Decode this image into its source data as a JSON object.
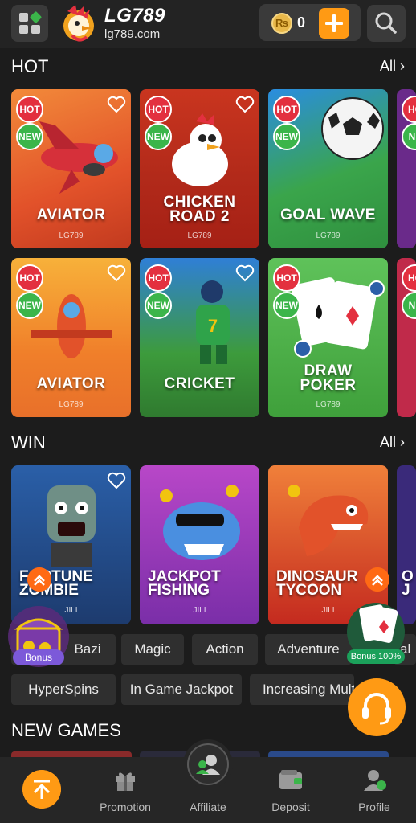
{
  "header": {
    "logo_title": "LG789",
    "logo_url": "lg789.com",
    "balance": "0",
    "currency_symbol": "₨"
  },
  "sections": {
    "hot": {
      "title": "HOT",
      "all_label": "All"
    },
    "win": {
      "title": "WIN",
      "all_label": "All"
    },
    "new_games": {
      "title": "NEW GAMES"
    }
  },
  "hot_games": [
    {
      "title_line1": "AVIATOR",
      "title_line2": "",
      "provider": "LG789",
      "hot": "HOT",
      "new": "NEW"
    },
    {
      "title_line1": "CHICKEN",
      "title_line2": "ROAD 2",
      "provider": "LG789",
      "hot": "HOT",
      "new": "NEW"
    },
    {
      "title_line1": "GOAL WAVE",
      "title_line2": "",
      "provider": "LG789",
      "hot": "HOT",
      "new": "NEW"
    },
    {
      "title_line1": "AVIATOR",
      "title_line2": "",
      "provider": "LG789",
      "hot": "HOT",
      "new": "NEW"
    },
    {
      "title_line1": "CRICKET",
      "title_line2": "",
      "provider": "LG789",
      "hot": "HOT",
      "new": "NEW"
    },
    {
      "title_line1": "DRAW",
      "title_line2": "POKER",
      "provider": "LG789",
      "hot": "HOT",
      "new": "NEW"
    }
  ],
  "hot_peek_badges": {
    "hot": "HO",
    "new": "NE"
  },
  "win_games": [
    {
      "title_line1": "FORTUNE",
      "title_line2": "ZOMBIE",
      "provider": "JILI"
    },
    {
      "title_line1": "JACKPOT",
      "title_line2": "FISHING",
      "provider": "JILI"
    },
    {
      "title_line1": "DINOSAUR",
      "title_line2": "TYCOON",
      "provider": "JILI"
    }
  ],
  "win_peek_text": {
    "line1": "O",
    "line2": "J"
  },
  "categories_row1": [
    "Bazi",
    "Magic",
    "Action",
    "Adventure",
    "al"
  ],
  "categories_row2": [
    "HyperSpins",
    "In Game Jackpot",
    "Increasing Mult"
  ],
  "floating": {
    "bonus_label": "Bonus",
    "bonus_pct_label": "Bonus 100%"
  },
  "bottom_nav": {
    "promotion": "Promotion",
    "affiliate": "Affiliate",
    "deposit": "Deposit",
    "profile": "Profile"
  },
  "colors": {
    "accent": "#ff9a14",
    "background": "#1c1c1c",
    "hot_badge": "#e3303f",
    "new_badge": "#3bb54a"
  }
}
